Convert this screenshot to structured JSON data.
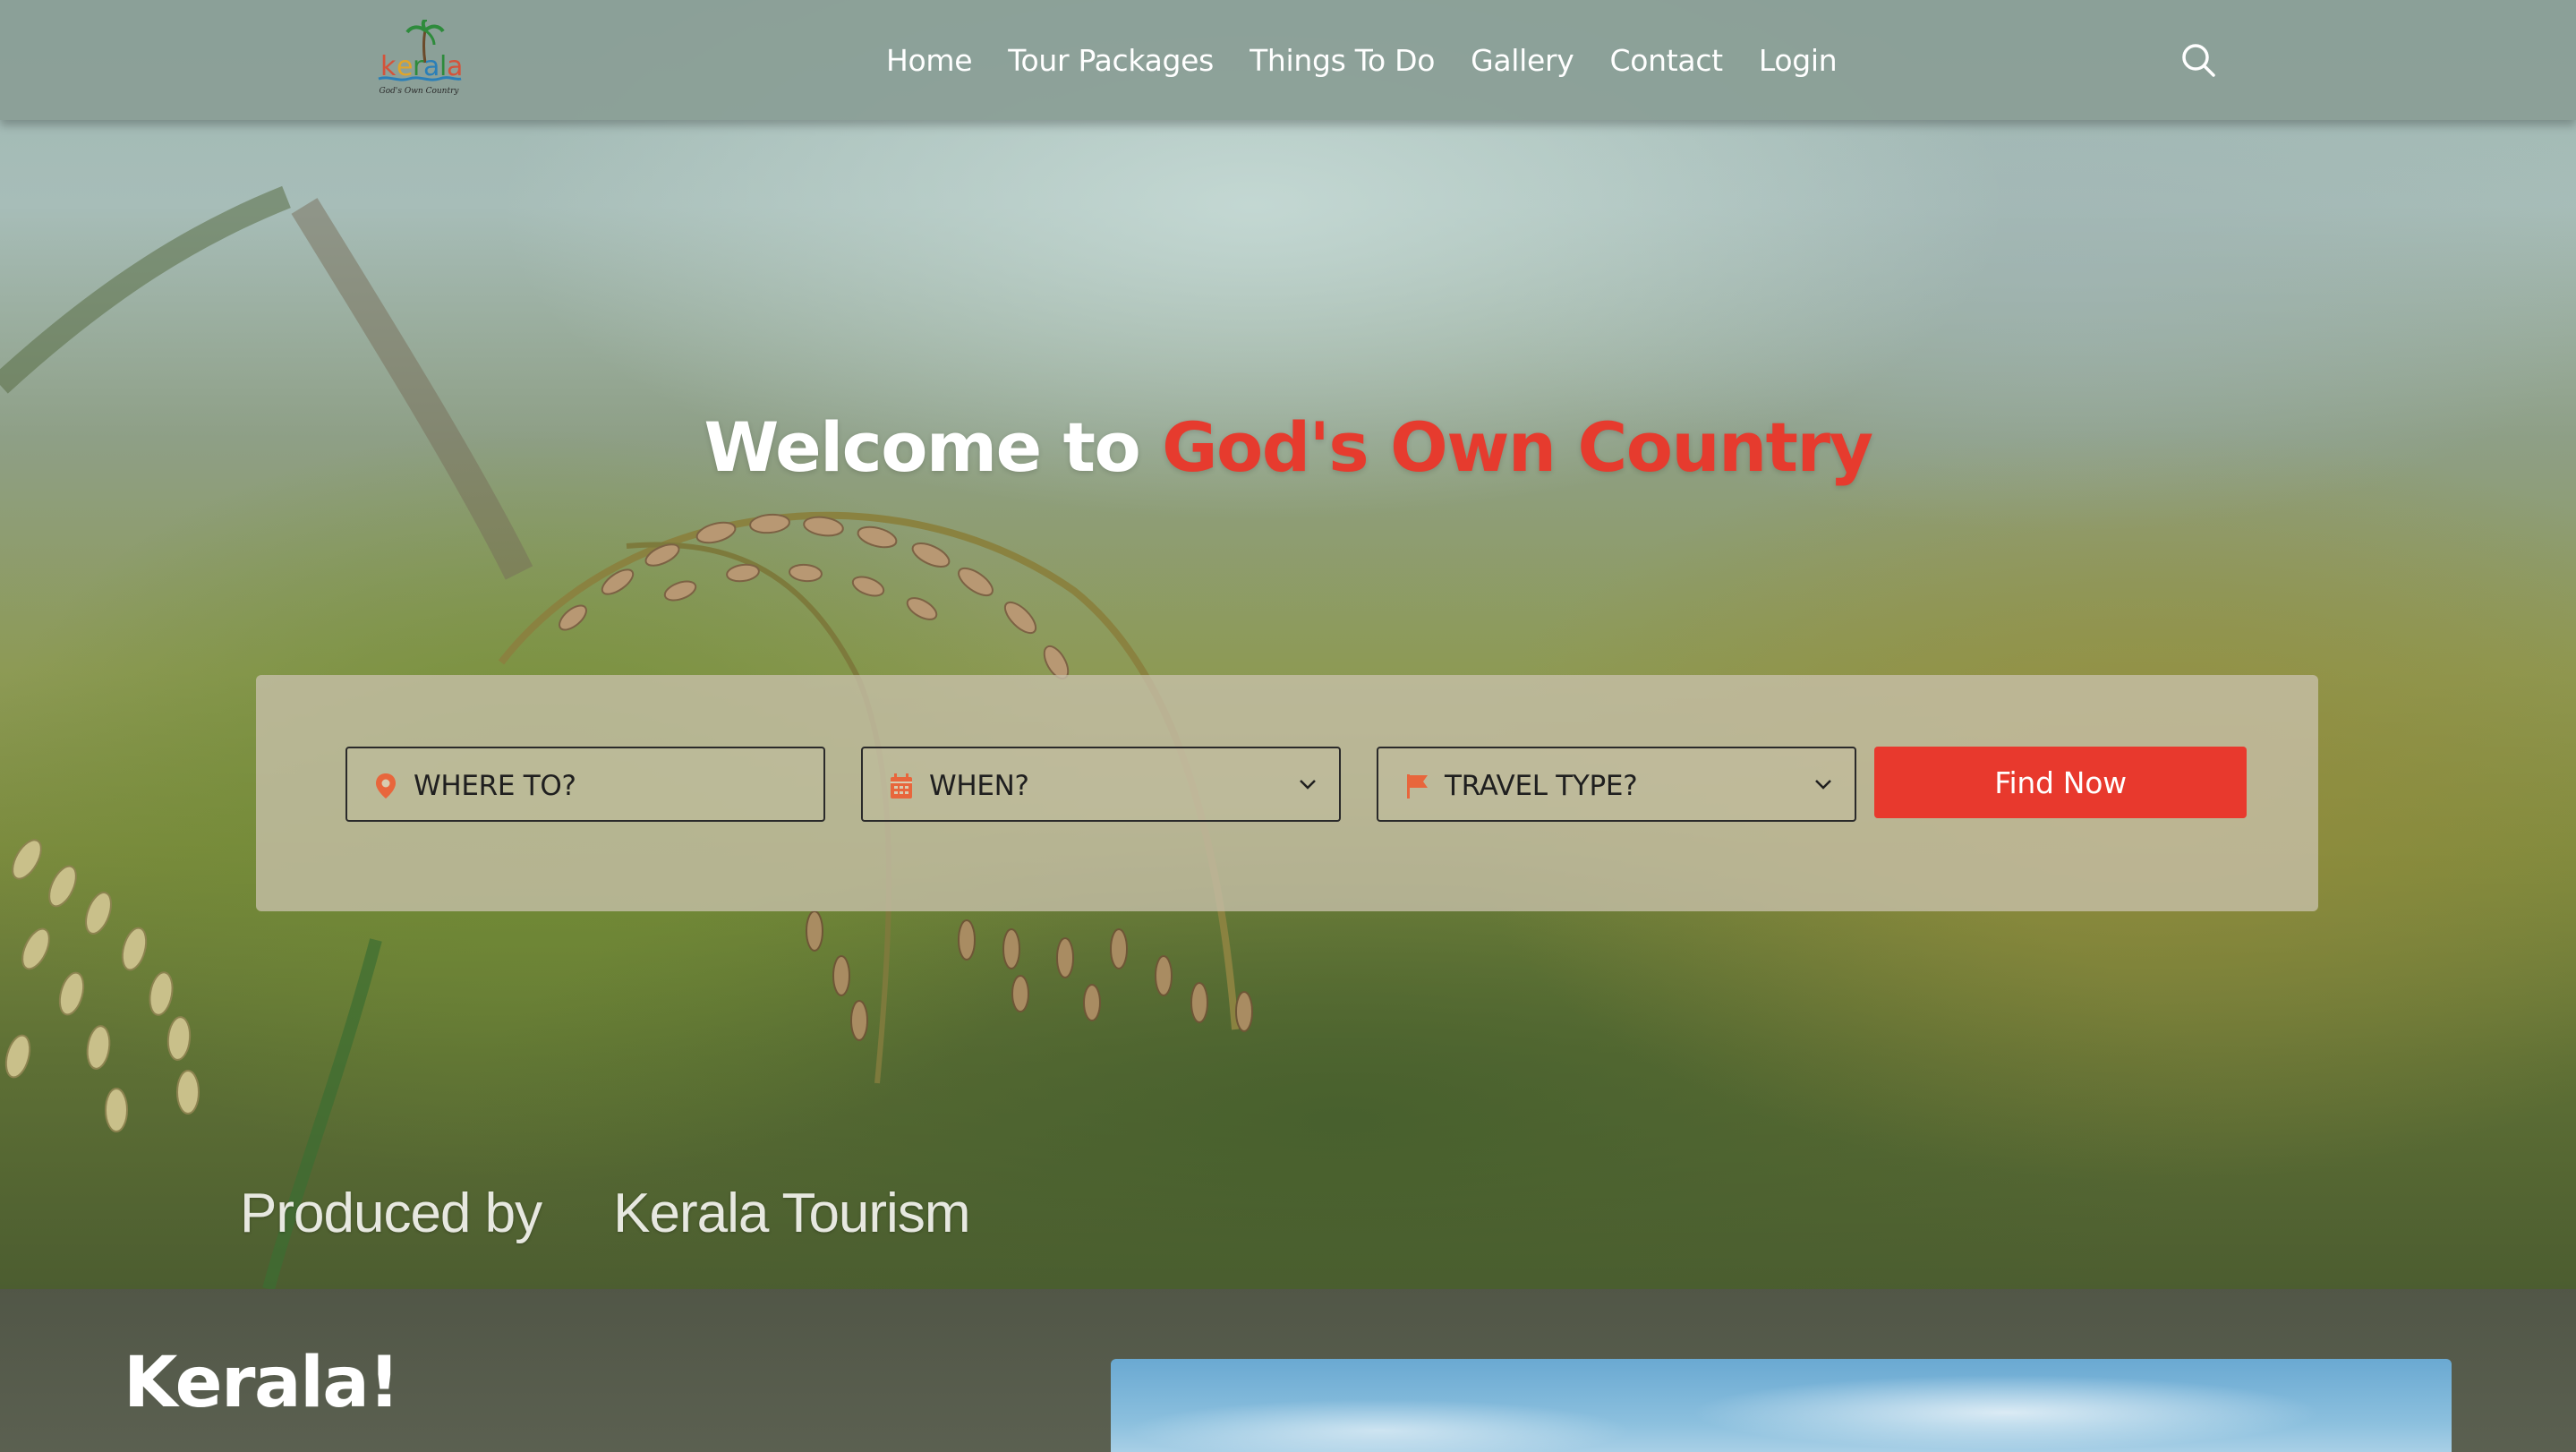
{
  "navbar": {
    "logo_text": "kerala",
    "logo_tagline": "God's Own Country",
    "items": [
      {
        "label": "Home"
      },
      {
        "label": "Tour Packages"
      },
      {
        "label": "Things To Do"
      },
      {
        "label": "Gallery"
      },
      {
        "label": "Contact"
      },
      {
        "label": "Login"
      }
    ],
    "search_icon": "search-icon"
  },
  "hero": {
    "headline_prefix": "Welcome to ",
    "headline_accent": "God's Own Country",
    "credit_left": "Produced by",
    "credit_right": "Kerala Tourism"
  },
  "search": {
    "where_label": "WHERE TO?",
    "when_label": "WHEN?",
    "type_label": "TRAVEL TYPE?",
    "find_button": "Find Now",
    "icons": {
      "where": "map-pin-icon",
      "when": "calendar-icon",
      "type": "flag-icon"
    }
  },
  "section": {
    "title": "Kerala!"
  },
  "colors": {
    "accent": "#e8392d",
    "navbar_bg": "#8a9e96",
    "icon_orange": "#e8663c"
  }
}
